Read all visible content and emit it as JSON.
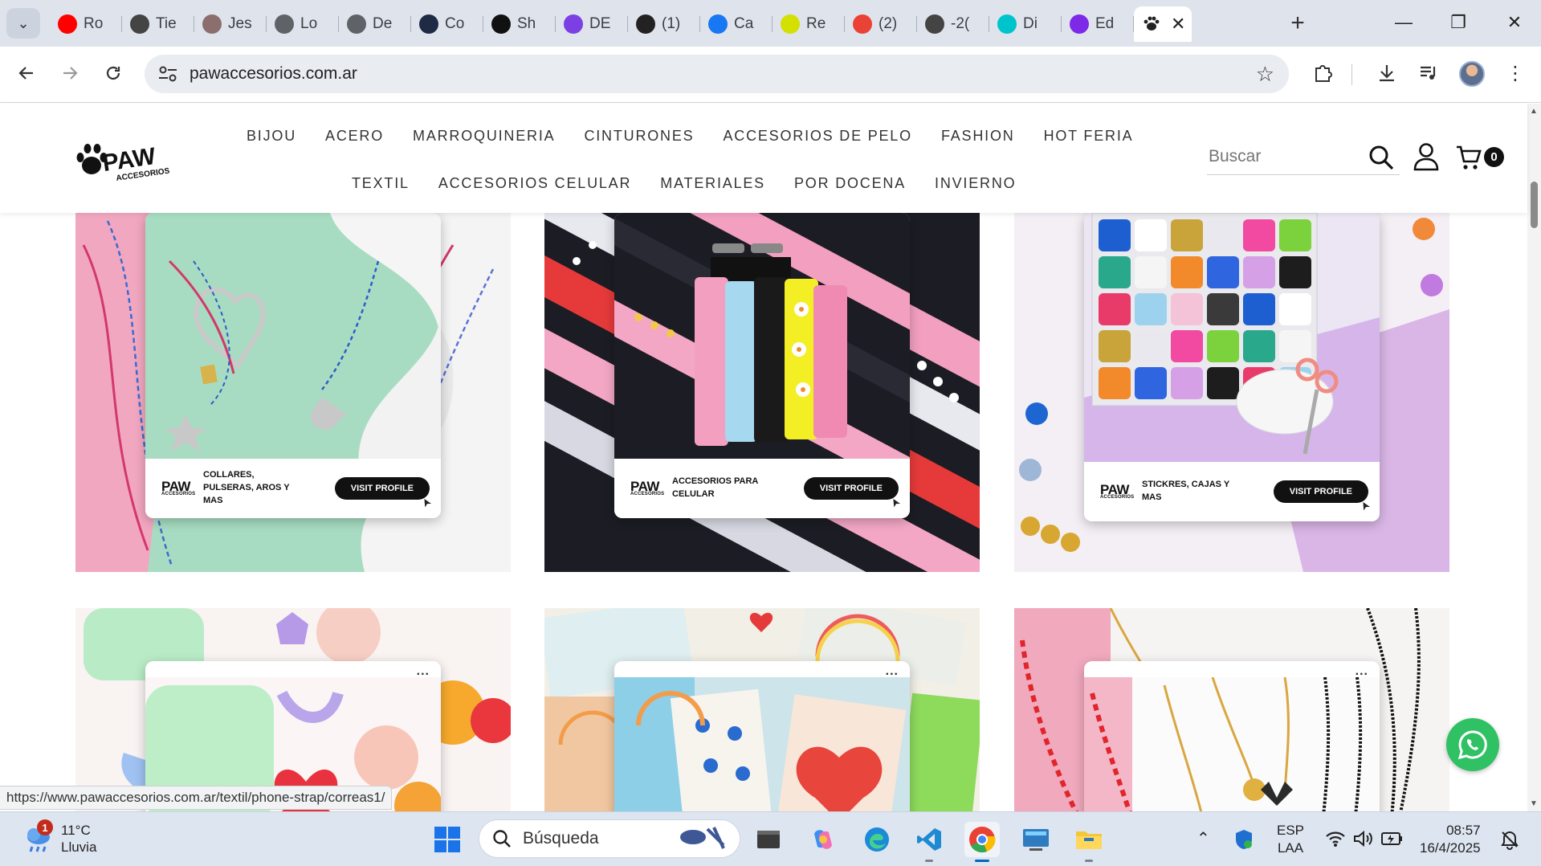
{
  "browser": {
    "tabs": [
      {
        "title": "Ro",
        "icon": "youtube-icon",
        "color": "#ff0000"
      },
      {
        "title": "Tie",
        "icon": "heart-icon",
        "color": "#444444"
      },
      {
        "title": "Jes",
        "icon": "eye-icon",
        "color": "#8c6e6e"
      },
      {
        "title": "Lo",
        "icon": "globe-icon",
        "color": "#5f6368"
      },
      {
        "title": "De",
        "icon": "globe-icon",
        "color": "#5f6368"
      },
      {
        "title": "Co",
        "icon": "hexagon-icon",
        "color": "#1f2a44"
      },
      {
        "title": "Sh",
        "icon": "openai-icon",
        "color": "#111111"
      },
      {
        "title": "DE",
        "icon": "b-icon",
        "color": "#7b3fe4"
      },
      {
        "title": "(1)",
        "icon": "tv-icon",
        "color": "#222222"
      },
      {
        "title": "Ca",
        "icon": "facebook-icon",
        "color": "#1877f2"
      },
      {
        "title": "Re",
        "icon": "id-icon",
        "color": "#d4e000"
      },
      {
        "title": "(2)",
        "icon": "gmail-icon",
        "color": "#ea4335"
      },
      {
        "title": "-2(",
        "icon": "heart-icon",
        "color": "#444444"
      },
      {
        "title": "Di",
        "icon": "canva-icon",
        "color": "#00c4cc"
      },
      {
        "title": "Ed",
        "icon": "canva-icon",
        "color": "#7d2ae8"
      }
    ],
    "active_tab_icon": "paw-icon",
    "url": "pawaccesorios.com.ar",
    "status_url": "https://www.pawaccesorios.com.ar/textil/phone-strap/correas1/"
  },
  "site": {
    "logo_text": "PAW",
    "logo_sub": "ACCESORIOS",
    "nav_row1": [
      "BIJOU",
      "ACERO",
      "MARROQUINERIA",
      "CINTURONES",
      "ACCESORIOS DE PELO",
      "FASHION",
      "HOT FERIA"
    ],
    "nav_row2": [
      "TEXTIL",
      "ACCESORIOS CELULAR",
      "MATERIALES",
      "POR DOCENA",
      "INVIERNO"
    ],
    "search_placeholder": "Buscar",
    "cart_count": "0"
  },
  "cards": [
    {
      "caption": "COLLARES, PULSERAS, AROS Y MAS",
      "button": "VISIT PROFILE",
      "logo": "PAW",
      "logo_sub": "ACCESORIOS",
      "theme": "jewelry-pink-mint"
    },
    {
      "caption": "ACCESORIOS PARA CELULAR",
      "button": "VISIT PROFILE",
      "logo": "PAW",
      "logo_sub": "ACCESORIOS",
      "theme": "phone-straps"
    },
    {
      "caption": "STICKRES, CAJAS Y MAS",
      "button": "VISIT PROFILE",
      "logo": "PAW",
      "logo_sub": "ACCESORIOS",
      "theme": "beads-box"
    },
    {
      "theme": "hair-clips",
      "menu": "..."
    },
    {
      "theme": "stickers",
      "menu": "..."
    },
    {
      "theme": "gold-necklaces",
      "menu": "..."
    }
  ],
  "taskbar": {
    "weather_temp": "11°C",
    "weather_desc": "Lluvia",
    "weather_badge": "1",
    "search_placeholder": "Búsqueda",
    "lang_line1": "ESP",
    "lang_line2": "LAA",
    "time": "08:57",
    "date": "16/4/2025"
  },
  "colors": {
    "accent_whatsapp": "#2fc163",
    "brand_black": "#111111",
    "tab_strip": "#dfe3eb"
  }
}
